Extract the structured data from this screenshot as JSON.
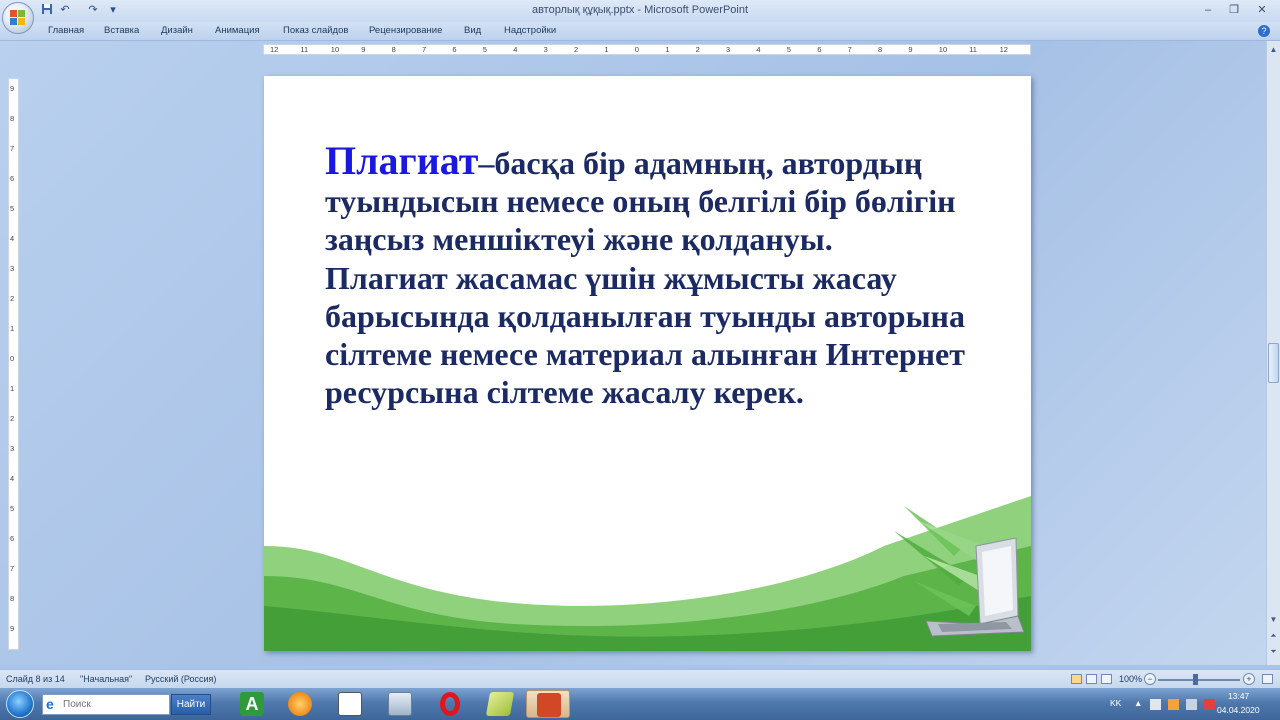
{
  "window": {
    "title": "авторлық құқық.pptx - Microsoft PowerPoint",
    "controls": {
      "minimize": "–",
      "maximize": "❐",
      "close": "✕"
    }
  },
  "quick_access": {
    "save_icon": "save-icon",
    "undo": "↶",
    "redo": "↷",
    "more": "▾"
  },
  "ribbon": {
    "tabs": [
      "Главная",
      "Вставка",
      "Дизайн",
      "Анимация",
      "Показ слайдов",
      "Рецензирование",
      "Вид",
      "Надстройки"
    ],
    "help": "?"
  },
  "ruler": {
    "horizontal": [
      "12",
      "11",
      "10",
      "9",
      "8",
      "7",
      "6",
      "5",
      "4",
      "3",
      "2",
      "1",
      "0",
      "1",
      "2",
      "3",
      "4",
      "5",
      "6",
      "7",
      "8",
      "9",
      "10",
      "11",
      "12"
    ],
    "vertical": [
      "9",
      "8",
      "7",
      "6",
      "5",
      "4",
      "3",
      "2",
      "1",
      "0",
      "1",
      "2",
      "3",
      "4",
      "5",
      "6",
      "7",
      "8",
      "9"
    ]
  },
  "slide": {
    "keyword": "Плагиат",
    "definition": "–басқа бір адамның, автордың туындысын немесе оның белгілі бір бөлігін заңсыз меншіктеуі және қолдануы.",
    "paragraph2": "Плагиат жасамас үшін жұмысты жасау барысында қолданылған туынды авторына сілтеме немесе материал алынған Интернет ресурсына сілтеме жасалу керек.",
    "colors": {
      "keyword": "#1a18e0",
      "text": "#1b2a63",
      "wave": "#5db54a"
    }
  },
  "statusbar": {
    "slide_counter": "Слайд 8 из 14",
    "theme": "\"Начальная\"",
    "language": "Русский (Россия)",
    "zoom": "100%",
    "zoom_minus": "−",
    "zoom_plus": "+",
    "zoom_level": 1.0
  },
  "taskbar": {
    "search_placeholder": "Поиск",
    "search_button": "Найти",
    "apps": [
      "calculator-app-icon",
      "media-player-icon",
      "document-icon",
      "calculator-icon",
      "opera-icon",
      "notes-icon",
      "powerpoint-icon"
    ],
    "language": "KK",
    "time": "13:47",
    "date": "04.04.2020"
  }
}
